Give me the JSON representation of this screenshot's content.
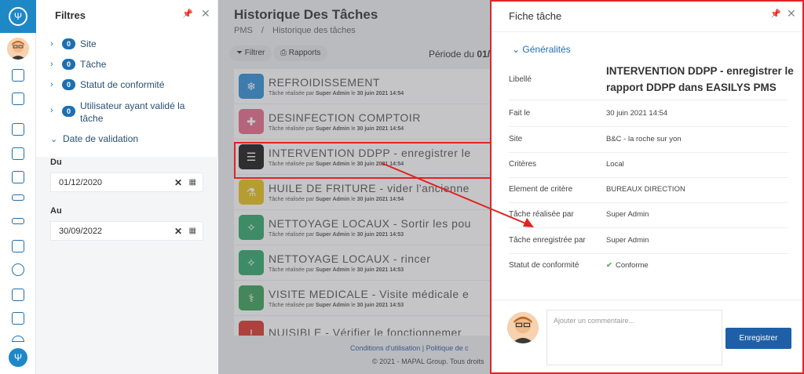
{
  "filters": {
    "title": "Filtres",
    "items": [
      {
        "count": "0",
        "label": "Site"
      },
      {
        "count": "0",
        "label": "Tâche"
      },
      {
        "count": "0",
        "label": "Statut de conformité"
      },
      {
        "count": "0",
        "label": "Utilisateur ayant validé la",
        "label2": "tâche"
      }
    ],
    "date_section": "Date de validation",
    "from_label": "Du",
    "from_value": "01/12/2020",
    "to_label": "Au",
    "to_value": "30/09/2022"
  },
  "main": {
    "title": "Historique Des Tâches",
    "breadcrumb": [
      "PMS",
      "/",
      "Historique des tâches"
    ],
    "filter_btn": "Filtrer",
    "reports_btn": "Rapports",
    "periode_label": "Période du",
    "periode_value": "01/",
    "tasks": [
      {
        "title": "REFROIDISSEMENT",
        "by": "Tâche réalisée par",
        "user": "Super Admin",
        "le": "le",
        "date": "30 juin 2021 14:54",
        "color": "#2f8fd6",
        "icon": "❄"
      },
      {
        "title": "DESINFECTION COMPTOIR",
        "by": "Tâche réalisée par",
        "user": "Super Admin",
        "le": "le",
        "date": "30 juin 2021 14:54",
        "color": "#e96a8a",
        "icon": "✚"
      },
      {
        "title": "INTERVENTION DDPP - enregistrer le",
        "by": "Tâche réalisée par",
        "user": "Super Admin",
        "le": "le",
        "date": "30 juin 2021 14:54",
        "color": "#1a1a1a",
        "icon": "☰"
      },
      {
        "title": "HUILE DE FRITURE - vider l'ancienne",
        "by": "Tâche réalisée par",
        "user": "Super Admin",
        "le": "le",
        "date": "30 juin 2021 14:54",
        "color": "#e8c21a",
        "icon": "⚗"
      },
      {
        "title": "NETTOYAGE LOCAUX - Sortir les pou",
        "by": "Tâche réalisée par",
        "user": "Super Admin",
        "le": "le",
        "date": "30 juin 2021 14:53",
        "color": "#2ea86a",
        "icon": "✧"
      },
      {
        "title": "NETTOYAGE LOCAUX - rincer",
        "by": "Tâche réalisée par",
        "user": "Super Admin",
        "le": "le",
        "date": "30 juin 2021 14:53",
        "color": "#2ea86a",
        "icon": "✧"
      },
      {
        "title": "VISITE MEDICALE - Visite médicale e",
        "by": "Tâche réalisée par",
        "user": "Super Admin",
        "le": "le",
        "date": "30 juin 2021 14:53",
        "color": "#3aa05a",
        "icon": "⚕"
      },
      {
        "title": "NUISIBLE - Vérifier le fonctionnemer",
        "by": "",
        "user": "",
        "le": "",
        "date": "",
        "color": "#d9362b",
        "icon": "!"
      }
    ],
    "footer_links": "Conditions d'utilisation   |   Politique de c",
    "footer_copy": "© 2021 - MAPAL Group. Tous droits"
  },
  "drawer": {
    "title": "Fiche tâche",
    "section": "Généralités",
    "fields": [
      {
        "key": "Libellé",
        "value": "INTERVENTION DDPP - enregistrer le rapport DDPP dans EASILYS PMS"
      },
      {
        "key": "Fait le",
        "value": "30 juin 2021 14:54"
      },
      {
        "key": "Site",
        "value": "B&C - la roche sur yon"
      },
      {
        "key": "Critères",
        "value": "Local"
      },
      {
        "key": "Element de critère",
        "value": "BUREAUX DIRECTION"
      },
      {
        "key": "Tâche réalisée par",
        "value": "Super Admin"
      },
      {
        "key": "Tâche enregistrée par",
        "value": "Super Admin"
      },
      {
        "key": "Statut de conformité",
        "value": "Conforme"
      }
    ],
    "comment_placeholder": "Ajouter un commentaire...",
    "save_label": "Enregistrer"
  },
  "colors": {
    "accent": "#1e6fb0",
    "highlight": "#e02424",
    "save": "#1e5fa8"
  }
}
